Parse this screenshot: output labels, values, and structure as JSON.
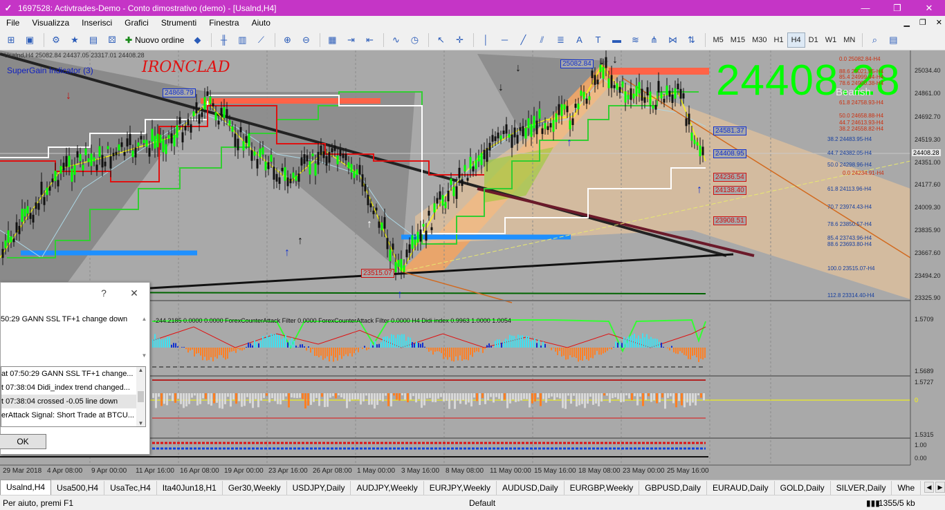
{
  "window": {
    "title": "1697528: Activtrades-Demo - Conto dimostrativo (demo) - [Usalnd,H4]"
  },
  "menu": [
    "File",
    "Visualizza",
    "Inserisci",
    "Grafici",
    "Strumenti",
    "Finestra",
    "Aiuto"
  ],
  "toolbar": {
    "new_order_label": "Nuovo ordine"
  },
  "timeframes": [
    "M5",
    "M15",
    "M30",
    "H1",
    "H4",
    "D1",
    "W1",
    "MN"
  ],
  "active_timeframe": "H4",
  "chart": {
    "info_line": "UsaInd,H4  25082.84 24437.05 23317.01 24408.28",
    "indicator_name": "SuperGain Indicator (3)",
    "logo_text": "IRONCLAD",
    "big_price": "24408.28",
    "signal": "Bearish",
    "price_boxes": {
      "p1": "24868.79",
      "p2": "25082.84",
      "p3": "24581.37",
      "p4": "24408.95",
      "p5": "24236.54",
      "p6": "24138.40",
      "p7": "23908.51",
      "p8": "23515.07"
    },
    "fib_levels": {
      "f0": "0.0 25082.84-H4",
      "f1": "88.6 25021.85-H4",
      "f2": "85.4 24999.44-H4",
      "f3": "78.6 24900.38-H4",
      "f4": "61.8 24758.93-H4",
      "f5": "50.0 24658.88-H4",
      "f6": "44.7 24613.93-H4",
      "f7": "38.2 24558.82-H4",
      "f8": "38.2 24483.95-H4",
      "f9": "44.7 24382.05-H4",
      "f10": "50.0 24298.96-H4",
      "f11": "0.0 24234.91-H4",
      "f12": "61.8 24113.96-H4",
      "f13": "70.7 23974.43-H4",
      "f14": "78.6 23850.57-H4",
      "f15": "85.4 23743.96-H4",
      "f16": "88.6 23693.80-H4",
      "f17": "100.0 23515.07-H4",
      "f18": "112.8 23314.40-H4"
    },
    "price_axis": {
      "a1": "25034.40",
      "a2": "24861.00",
      "a3": "24692.70",
      "a4": "24519.30",
      "a5": "24351.00",
      "a6": "24177.60",
      "a7": "24009.30",
      "a8": "23835.90",
      "a9": "23667.60",
      "a10": "23494.20",
      "a11": "23325.90"
    },
    "current_price": "24408.28",
    "sub1_label": "-244.2185 0.0000 0.0000  ForexCounterAttack Filter 0.0000  ForexCounterAttack Filter 0.0000  H4 Didi index 0.9963 1.0000 1.0054",
    "sub1_axis": {
      "top": "1.5709",
      "bottom": "1.5689"
    },
    "sub2_axis": {
      "top": "1.5727",
      "mid": "0",
      "bottom": "1.5315"
    },
    "sub3_axis": {
      "a": "1.00",
      "b": "0.00"
    },
    "dates": [
      "29 Mar 2018",
      "4 Apr 08:00",
      "9 Apr 00:00",
      "11 Apr 16:00",
      "16 Apr 08:00",
      "19 Apr 00:00",
      "23 Apr 16:00",
      "26 Apr 08:00",
      "1 May 00:00",
      "3 May 16:00",
      "8 May 08:00",
      "11 May 00:00",
      "15 May 16:00",
      "18 May 08:00",
      "23 May 00:00",
      "25 May 16:00"
    ]
  },
  "alert_dialog": {
    "help": "?",
    "close": "✕",
    "message": "50:29 GANN SSL TF+1 change down",
    "list": [
      "at 07:50:29 GANN SSL TF+1 change...",
      "t 07:38:04 Didi_index trend changed...",
      "t 07:38:04 crossed -0.05 line down",
      "erAttack Signal: Short Trade at BTCU..."
    ],
    "ok": "OK"
  },
  "tabs": [
    "Usalnd,H4",
    "Usa500,H4",
    "UsaTec,H4",
    "Ita40Jun18,H1",
    "Ger30,Weekly",
    "USDJPY,Daily",
    "AUDJPY,Weekly",
    "EURJPY,Weekly",
    "AUDUSD,Daily",
    "EURGBP,Weekly",
    "GBPUSD,Daily",
    "EURAUD,Daily",
    "GOLD,Daily",
    "SILVER,Daily",
    "Whe"
  ],
  "status": {
    "help": "Per aiuto, premi F1",
    "profile": "Default",
    "traffic": "1355/5 kb"
  },
  "colors": {
    "titlebar": "#c535c6",
    "chart_bg": "#a9a9a9",
    "bull_candle": "#00ff00",
    "big_price": "#00ff00"
  }
}
